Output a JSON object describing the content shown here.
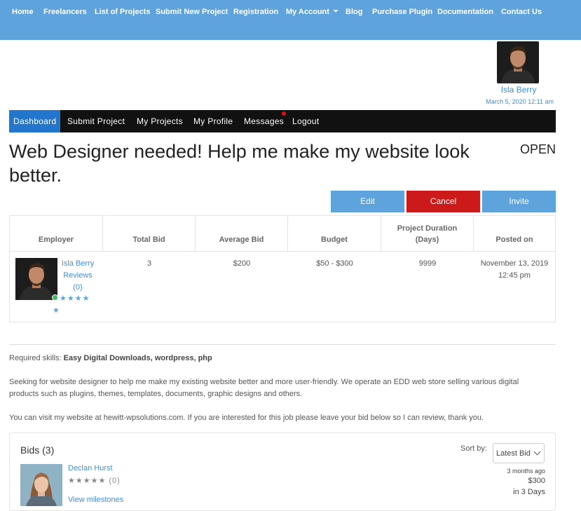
{
  "topnav": {
    "items": [
      "Home",
      "Freelancers",
      "List of Projects",
      "Submit New Project",
      "Registration",
      "My Account",
      "Blog",
      "Purchase Plugin",
      "Documentation",
      "Contact Us"
    ]
  },
  "user": {
    "name": "Isla Berry",
    "datetime": "March 5, 2020 12:11 am"
  },
  "subnav": {
    "items": [
      "Dashboard",
      "Submit Project",
      "My Projects",
      "My Profile",
      "Messages",
      "Logout"
    ]
  },
  "project": {
    "title": "Web Designer needed! Help me make my website look better.",
    "status": "OPEN"
  },
  "actions": {
    "edit": "Edit",
    "cancel": "Cancel",
    "invite": "Invite"
  },
  "colors": {
    "accent": "#5fa3dc",
    "cancel": "#cc1a1a",
    "active_tab": "#2277cc",
    "online": "#3cba54"
  },
  "table": {
    "headers": [
      "Employer",
      "Total Bid",
      "Average Bid",
      "Budget",
      "Project Duration (Days)",
      "Posted on"
    ],
    "employer": {
      "name": "Isla Berry",
      "reviews": "Reviews",
      "reviews_count": "(0)",
      "stars": "★★★★★"
    },
    "total_bid": "3",
    "average_bid": "$200",
    "budget": "$50 - $300",
    "duration": "9999",
    "posted_on": "November 13, 2019 12:45 pm"
  },
  "details": {
    "skills_label": "Required skills:",
    "skills": "Easy Digital Downloads, wordpress, php",
    "description": "Seeking for website designer to help me make my existing website better and more user-friendly. We operate an EDD web store selling various digital products such as plugins, themes, templates, documents, graphic designs and others.",
    "note": "You can visit my website at hewitt-wpsolutions.com. If you are interested for this job please leave your bid below so I can review, thank you."
  },
  "bids": {
    "title": "Bids (3)",
    "sort_label": "Sort by:",
    "sort_value": "Latest Bid",
    "items": [
      {
        "name": "Declan Hurst",
        "stars": "★★★★★",
        "rating": "(0)",
        "link": "View milestones",
        "time": "3 months ago",
        "amount": "$300",
        "duration": "in 3 Days"
      }
    ]
  }
}
